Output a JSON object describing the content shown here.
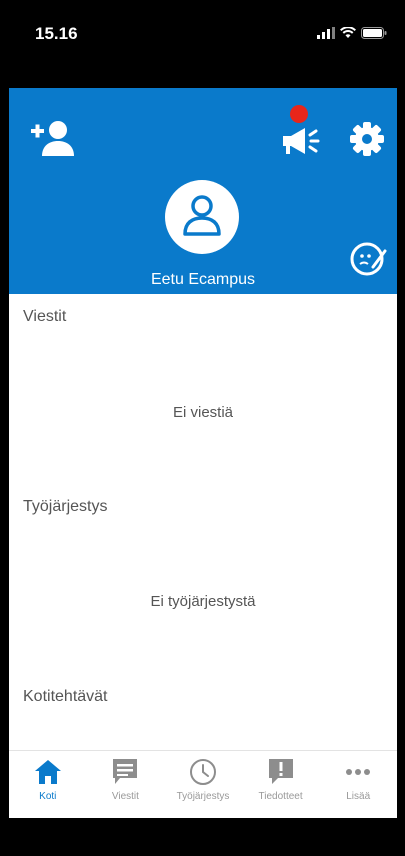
{
  "status_bar": {
    "time": "15.16"
  },
  "header": {
    "user_name": "Eetu Ecampus",
    "background_color": "#0a7acb",
    "notification_dot_color": "#e8261b"
  },
  "sections": [
    {
      "title": "Viestit",
      "empty_text": "Ei viestiä"
    },
    {
      "title": "Työjärjestys",
      "empty_text": "Ei työjärjestystä"
    },
    {
      "title": "Kotitehtävät"
    }
  ],
  "tabs": [
    {
      "label": "Koti",
      "icon": "home-icon",
      "active": true
    },
    {
      "label": "Viestit",
      "icon": "message-icon"
    },
    {
      "label": "Työjärjestys",
      "icon": "clock-icon"
    },
    {
      "label": "Tiedotteet",
      "icon": "announcement-icon"
    },
    {
      "label": "Lisää",
      "icon": "more-icon"
    }
  ]
}
